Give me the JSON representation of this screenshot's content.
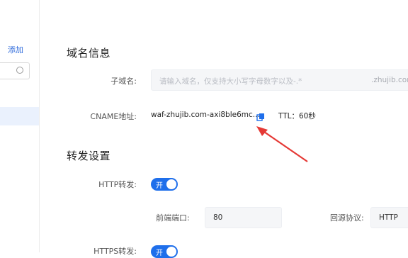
{
  "sidebar": {
    "add_label": "添加"
  },
  "domain_info": {
    "title": "域名信息",
    "subdomain_label": "子域名:",
    "subdomain_placeholder": "请输入域名，仅支持大小写字母数字以及-.*",
    "domain_suffix": ".zhujib.com",
    "cname_label": "CNAME地址:",
    "cname_value": "waf-zhujib.com-axi8ble6mc....",
    "ttl": "TTL：60秒"
  },
  "forwarding": {
    "title": "转发设置",
    "http_label": "HTTP转发:",
    "http_toggle": "开",
    "frontend_port_label": "前端端口:",
    "frontend_port_value": "80",
    "origin_protocol_label": "回源协议:",
    "origin_protocol_value": "HTTP",
    "https_label": "HTTPS转发:",
    "https_toggle": "开"
  },
  "colors": {
    "accent": "#1f6feb",
    "arrow": "#e53935"
  }
}
